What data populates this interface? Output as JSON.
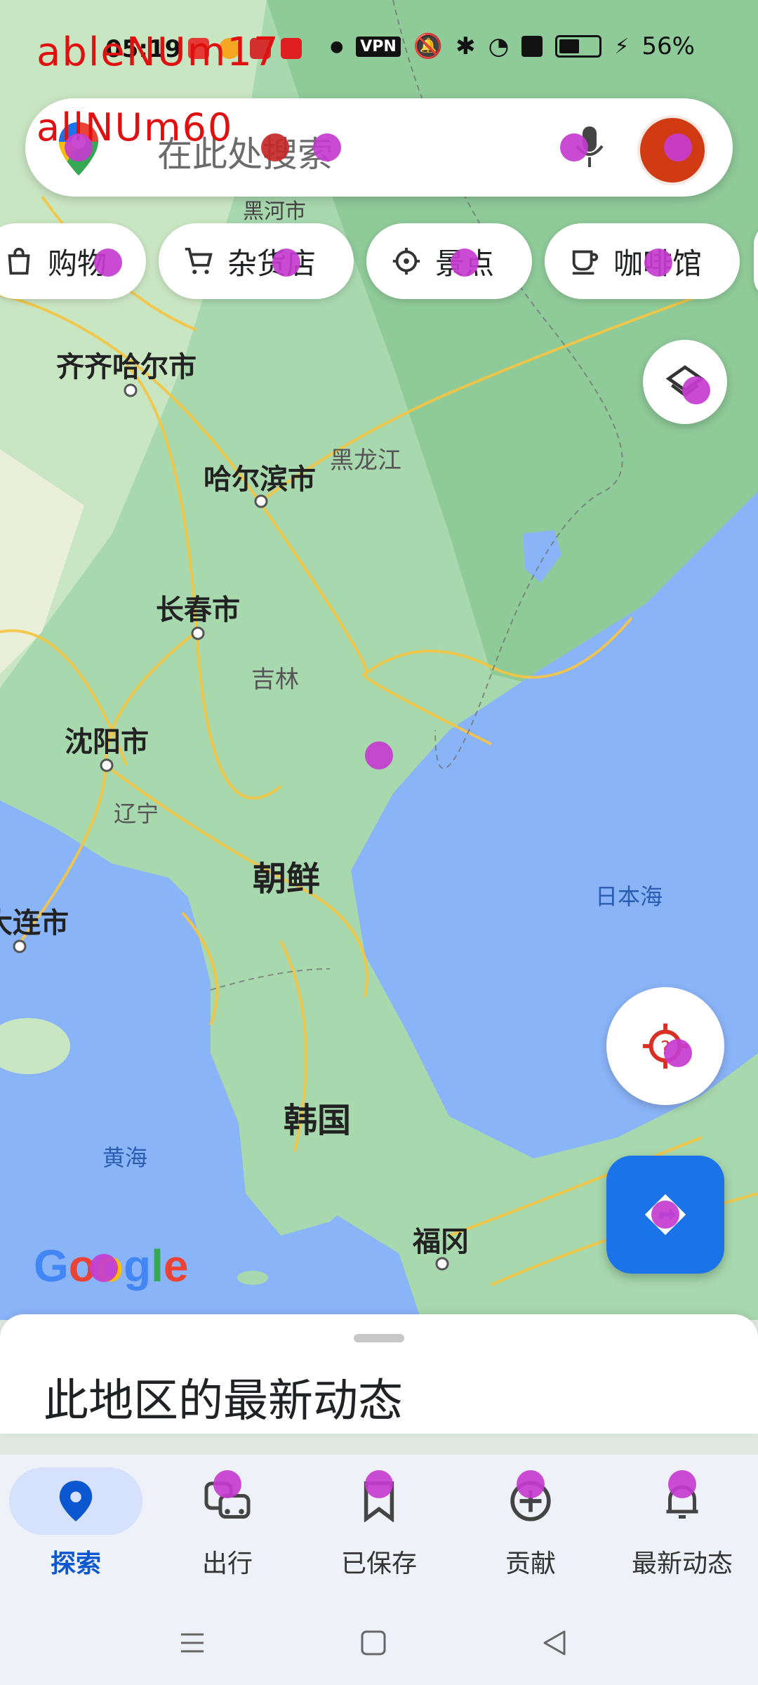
{
  "status_bar": {
    "time": "05:19",
    "vpn": "VPN",
    "battery_percent": "56%"
  },
  "debug_overlay": {
    "line1": "ableNUm17",
    "line2": "allNUm60"
  },
  "search": {
    "placeholder": "在此处搜索"
  },
  "chips": [
    {
      "label": "购物",
      "icon": "shopping-bag-icon"
    },
    {
      "label": "杂货店",
      "icon": "cart-icon"
    },
    {
      "label": "景点",
      "icon": "attraction-icon"
    },
    {
      "label": "咖啡馆",
      "icon": "coffee-icon"
    }
  ],
  "map_labels": {
    "heihe": "黑河市",
    "qiqihar": "齐齐哈尔市",
    "heilongjiang": "黑龙江",
    "harbin": "哈尔滨市",
    "changchun": "长春市",
    "jilin": "吉林",
    "shenyang": "沈阳市",
    "liaoning": "辽宁",
    "dalian": "大连市",
    "north_korea": "朝鲜",
    "sea_of_japan": "日本海",
    "south_korea": "韩国",
    "yellow_sea": "黄海",
    "fukuoka": "福冈"
  },
  "google_logo": "Google",
  "sheet": {
    "title": "此地区的最新动态"
  },
  "nav": [
    {
      "label": "探索",
      "icon": "explore-pin-icon",
      "active": true
    },
    {
      "label": "出行",
      "icon": "commute-icon",
      "active": false
    },
    {
      "label": "已保存",
      "icon": "bookmark-icon",
      "active": false
    },
    {
      "label": "贡献",
      "icon": "contribute-icon",
      "active": false
    },
    {
      "label": "最新动态",
      "icon": "bell-icon",
      "active": false
    }
  ],
  "colors": {
    "land": "#9ed3a6",
    "water": "#8ab4f8",
    "roads": "#f5c542",
    "accent": "#1a73e8",
    "active_nav": "#0b57d0"
  }
}
